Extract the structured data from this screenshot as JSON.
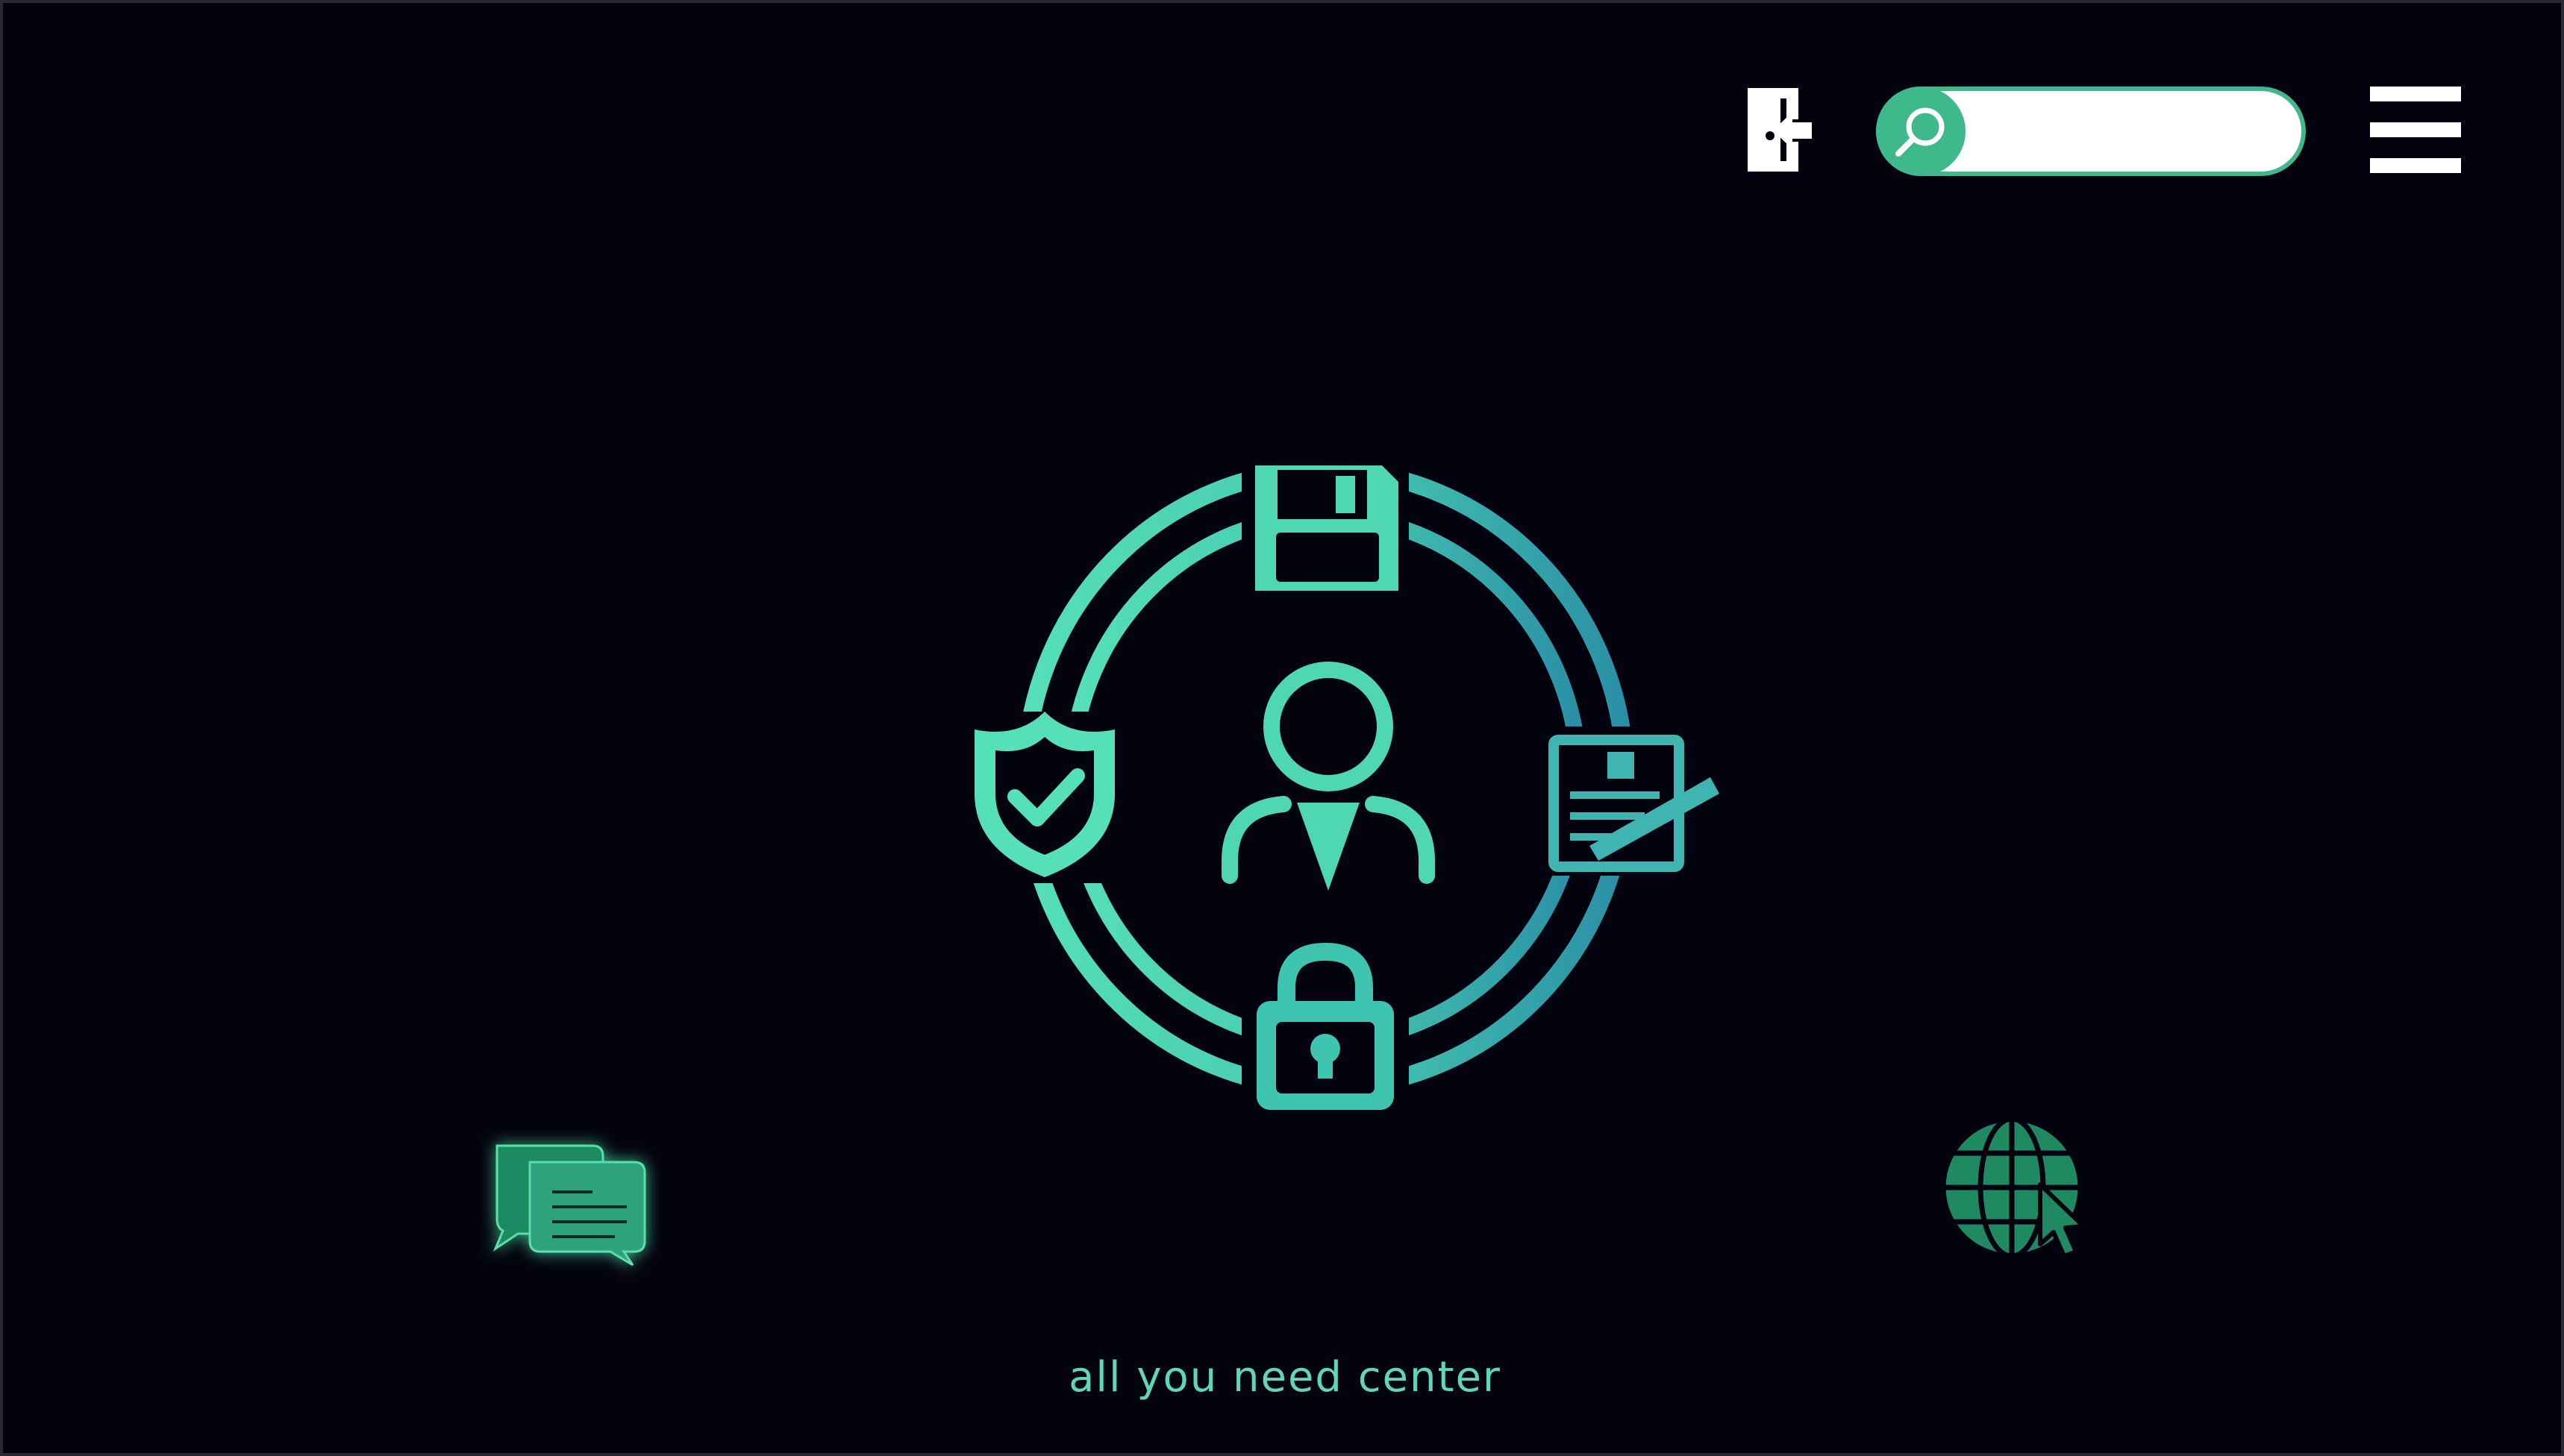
{
  "header": {
    "logout_icon": "logout-door-icon",
    "search": {
      "icon": "search-icon",
      "value": "",
      "placeholder": ""
    },
    "menu_icon": "hamburger-menu-icon"
  },
  "hero": {
    "emblem_icons": [
      "floppy-disk-icon",
      "shield-check-icon",
      "user-icon",
      "document-signature-icon",
      "padlock-icon"
    ]
  },
  "floating_actions": {
    "chat_icon": "chat-bubbles-icon",
    "globe_icon": "globe-cursor-icon"
  },
  "footer": {
    "tagline": "all you need center"
  },
  "colors": {
    "background": "#03030f",
    "accent": "#3fb88c",
    "emblem": "#4fd6b4",
    "emblem_dark": "#2a8fa6",
    "chat": "#2fa27c",
    "globe": "#1f8a62",
    "tagline": "#5fd6bb",
    "icon_white": "#ffffff"
  }
}
